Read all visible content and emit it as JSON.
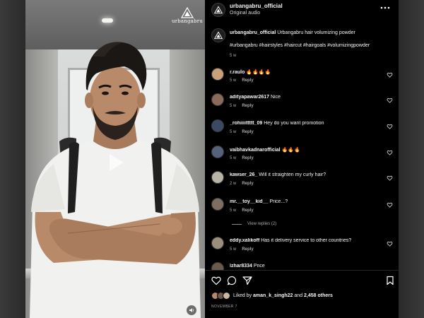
{
  "post": {
    "username": "urbangabru_official",
    "audio": "Original audio",
    "watermark_text": "urbangabru"
  },
  "caption": {
    "username": "urbangabru_official",
    "text": "Urbangabru hair volumizing powder",
    "hashtags": "#urbangabru #hairstyles #haircut #hairgoals #volumizingpowder",
    "age": "5 w"
  },
  "comments": [
    {
      "username": "r.raulo",
      "text": "🔥🔥🔥🔥",
      "age": "5 w",
      "reply": "Reply",
      "avatar_color": "#c9a07a"
    },
    {
      "username": "adityapawar2617",
      "text": "Nice",
      "age": "5 w",
      "reply": "Reply",
      "avatar_color": "#8a6b5a"
    },
    {
      "username": "_rohiiiittttt_09",
      "text": "Hey do you want promotion",
      "age": "5 w",
      "reply": "Reply",
      "avatar_color": "#3b4a63"
    },
    {
      "username": "vaibhavkadnarofficial",
      "text": "🔥🔥🔥",
      "age": "5 w",
      "reply": "Reply",
      "avatar_color": "#54627a"
    },
    {
      "username": "kawser_26_",
      "text": "Will it straighten my curly hair?",
      "age": "2 w",
      "reply": "Reply",
      "avatar_color": "#b9b2a6"
    },
    {
      "username": "mr.__toy__kid__",
      "text": "Price...?",
      "age": "5 w",
      "reply": "Reply",
      "avatar_color": "#7c6f62"
    },
    {
      "username": "eddy.xalikoff",
      "text": "Has it delivery service to other countries?",
      "age": "5 w",
      "reply": "Reply",
      "avatar_color": "#9c8e7c"
    },
    {
      "username": "lzhar8334",
      "text": "Price",
      "age": "",
      "reply": "",
      "avatar_color": "#6a5a4c"
    }
  ],
  "view_replies": "View replies (2)",
  "likes": {
    "prefix": "Liked by",
    "user": "aman_k_singh22",
    "and": "and",
    "count": "2,458 others"
  },
  "date": "NOVEMBER 7",
  "colors": {
    "panel_bg": "#000000",
    "meta_gray": "#a8a8a8",
    "shirt": "#f1f1ef",
    "hair": "#1a1715",
    "skin": "#b88a6a"
  },
  "icons": [
    "ellipsis-icon",
    "heart-icon",
    "comment-icon",
    "share-icon",
    "bookmark-icon",
    "play-icon",
    "speaker-icon"
  ]
}
